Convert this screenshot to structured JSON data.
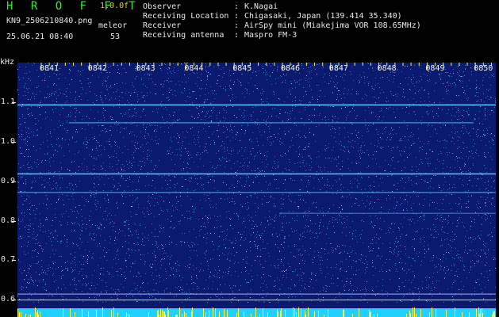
{
  "header": {
    "app_title": "H R O F F T",
    "version": "1.0.0f",
    "filename": "KN9_2506210840.png",
    "mode": "meleor",
    "count": "53",
    "datetime": "25.06.21 08:40"
  },
  "info": [
    {
      "label": "Observer",
      "value": "K.Nagai"
    },
    {
      "label": "Receiving Location",
      "value": "Chigasaki, Japan (139.414 35.340)"
    },
    {
      "label": "Receiver",
      "value": "AirSpy mini (Miakejima VOR 108.65MHz)"
    },
    {
      "label": "Receiving antenna",
      "value": "Maspro FM-3"
    }
  ],
  "spectrogram": {
    "unit": "kHz",
    "y_ticks": [
      "1.1",
      "1.0",
      "0.9",
      "0.8",
      "0.7",
      "0.6"
    ],
    "time_labels": [
      "0841",
      "0842",
      "0843",
      "0844",
      "0845",
      "0846",
      "0847",
      "0848",
      "0849",
      "0850"
    ],
    "ylim": [
      0.58,
      1.2
    ],
    "lines_khz": [
      1.1,
      1.055,
      0.925,
      0.878,
      0.825,
      0.62,
      0.605
    ],
    "colors": {
      "background": "#0a1a6e",
      "line": "#62c8ff",
      "noise": "#3a78d0",
      "baseline": "#20d0ff",
      "spike": "#ffff40",
      "tick": "#f0f080"
    }
  }
}
